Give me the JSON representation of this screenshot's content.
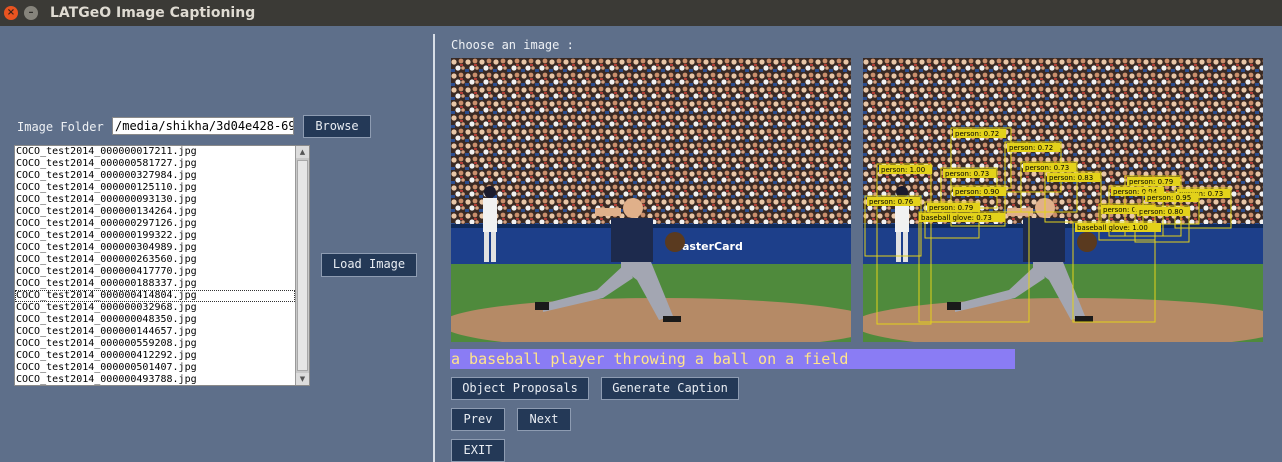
{
  "window": {
    "title": "LATGeO Image Captioning",
    "close_glyph": "×",
    "min_glyph": "–"
  },
  "left": {
    "folder_label": "Image Folder",
    "folder_value": "/media/shikha/3d04e428-69",
    "browse_label": "Browse",
    "load_label": "Load Image",
    "files": [
      "COCO_test2014_000000017211.jpg",
      "COCO_test2014_000000581727.jpg",
      "COCO_test2014_000000327984.jpg",
      "COCO_test2014_000000125110.jpg",
      "COCO_test2014_000000093130.jpg",
      "COCO_test2014_000000134264.jpg",
      "COCO_test2014_000000297126.jpg",
      "COCO_test2014_000000199322.jpg",
      "COCO_test2014_000000304989.jpg",
      "COCO_test2014_000000263560.jpg",
      "COCO_test2014_000000417770.jpg",
      "COCO_test2014_000000188337.jpg",
      "COCO_test2014_000000414804.jpg",
      "COCO_test2014_000000032968.jpg",
      "COCO_test2014_000000048350.jpg",
      "COCO_test2014_000000144657.jpg",
      "COCO_test2014_000000559208.jpg",
      "COCO_test2014_000000412292.jpg",
      "COCO_test2014_000000501407.jpg",
      "COCO_test2014_000000493788.jpg"
    ],
    "focused_index": 12
  },
  "right": {
    "choose_label": "Choose an image :",
    "banner_text": "MasterCard",
    "caption": "a baseball player throwing a ball on a field",
    "detections": [
      {
        "label": "person: 0.72"
      },
      {
        "label": "person: 0.72"
      },
      {
        "label": "person: 1.00"
      },
      {
        "label": "person: 0.73"
      },
      {
        "label": "person: 0.73"
      },
      {
        "label": "person: 0.83"
      },
      {
        "label": "person: 0.79"
      },
      {
        "label": "person: 0.90"
      },
      {
        "label": "person: 0.94"
      },
      {
        "label": "person: 0.73"
      },
      {
        "label": "person: 0.76"
      },
      {
        "label": "person: 0.79"
      },
      {
        "label": "person: 0.82"
      },
      {
        "label": "person: 0.80"
      },
      {
        "label": "person: 0.95"
      },
      {
        "label": "baseball glove: 0.73"
      },
      {
        "label": "baseball glove: 1.00"
      }
    ],
    "buttons": {
      "object_proposals": "Object Proposals",
      "generate_caption": "Generate Caption",
      "prev": "Prev",
      "next": "Next",
      "exit": "EXIT"
    }
  },
  "colors": {
    "background": "#5e6f8a",
    "button": "#243957",
    "caption_bg": "#8a7cf4",
    "caption_text": "#ffe48a",
    "detection_box": "#e3d21a"
  }
}
